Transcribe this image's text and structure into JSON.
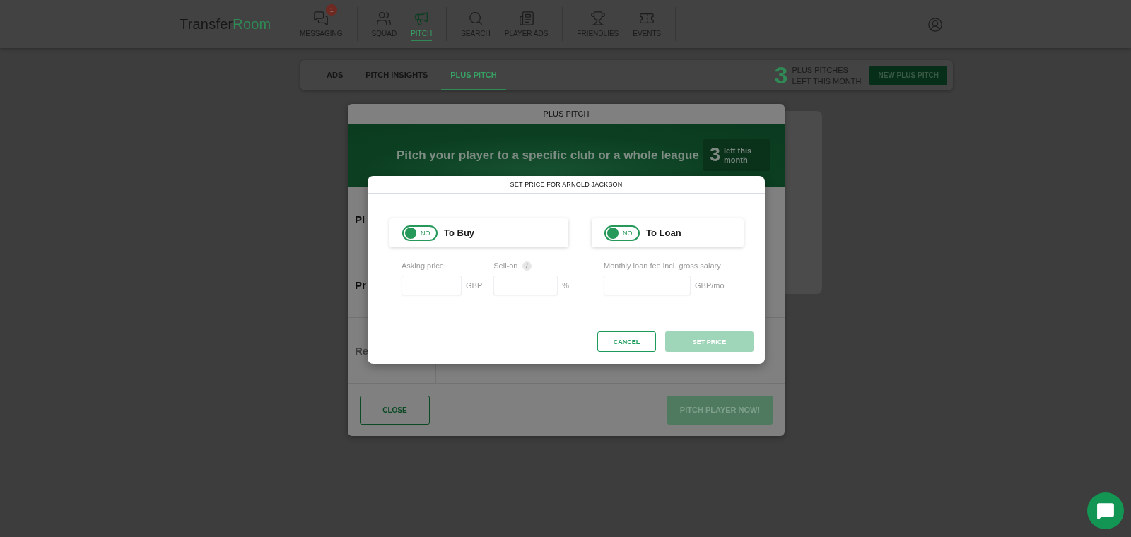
{
  "header": {
    "logo_main": "Transfer",
    "logo_accent": "Room",
    "nav_groups": [
      [
        {
          "kind": "messages",
          "label": "MESSAGING",
          "badge": "1",
          "selected": false
        }
      ],
      [
        {
          "kind": "squad",
          "label": "SQUAD",
          "selected": false
        },
        {
          "kind": "pitch",
          "label": "PITCH",
          "selected": true
        }
      ],
      [
        {
          "kind": "search",
          "label": "SEARCH",
          "selected": false
        },
        {
          "kind": "ads",
          "label": "PLAYER ADS",
          "selected": false
        }
      ],
      [
        {
          "kind": "friendlies",
          "label": "FRIENDLIES",
          "selected": false
        },
        {
          "kind": "events",
          "label": "EVENTS",
          "selected": false
        }
      ]
    ]
  },
  "subnav": {
    "tabs": [
      {
        "label": "ADS",
        "selected": false
      },
      {
        "label": "PITCH INSIGHTS",
        "selected": false
      },
      {
        "label": "PLUS PITCH",
        "selected": true
      }
    ],
    "counter": {
      "count": "3",
      "label_lines": [
        "PLUS PITCHES",
        "LEFT THIS MONTH"
      ]
    },
    "new_button": "NEW PLUS PITCH"
  },
  "plus_pitch_modal": {
    "title": "PLUS PITCH",
    "banner": {
      "headline": "Pitch your player to a specific club or a whole league",
      "count": "3",
      "count_label": "left this month"
    },
    "rows": [
      {
        "label": "Pl",
        "muted": false
      },
      {
        "label": "Pr",
        "muted": false
      },
      {
        "label": "Re",
        "muted": true
      }
    ],
    "close_button": "CLOSE",
    "submit_button": {
      "label": "PITCH PLAYER NOW!",
      "disabled": true
    }
  },
  "set_price_modal": {
    "title": "SET PRICE FOR ARNOLD JACKSON",
    "options": [
      {
        "label": "To Buy",
        "toggle": {
          "text": "NO",
          "on": false
        },
        "fields": [
          {
            "label": "Asking price",
            "unit": "GBP",
            "info": false
          },
          {
            "label": "Sell-on",
            "unit": "%",
            "info": true
          }
        ]
      },
      {
        "label": "To Loan",
        "toggle": {
          "text": "NO",
          "on": false
        },
        "fields": [
          {
            "label": "Monthly loan fee incl. gross salary",
            "unit": "GBP/mo",
            "info": false
          }
        ]
      }
    ],
    "cancel_button": "CANCEL",
    "confirm_button": {
      "label": "SET PRICE",
      "disabled": true
    }
  }
}
